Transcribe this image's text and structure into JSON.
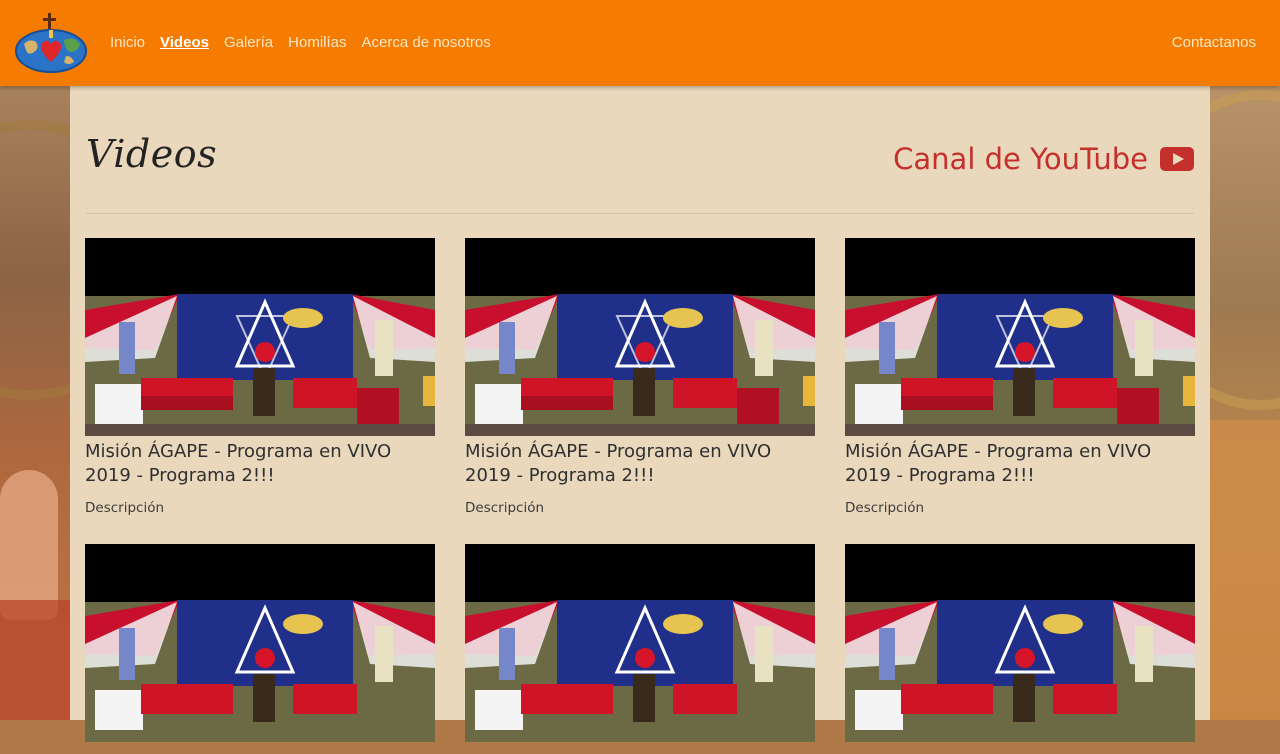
{
  "nav": {
    "links": [
      {
        "label": "Inicio"
      },
      {
        "label": "Videos"
      },
      {
        "label": "Galería"
      },
      {
        "label": "Homilías"
      },
      {
        "label": "Acerca de nosotros"
      }
    ],
    "contact_label": "Contactanos"
  },
  "page": {
    "title": "Videos",
    "youtube_label": "Canal de YouTube"
  },
  "videos": [
    {
      "title": "Misión ÁGAPE - Programa en VIVO 2019 - Programa 2!!!",
      "description": "Descripción"
    },
    {
      "title": "Misión ÁGAPE - Programa en VIVO 2019 - Programa 2!!!",
      "description": "Descripción"
    },
    {
      "title": "Misión ÁGAPE - Programa en VIVO 2019 - Programa 2!!!",
      "description": "Descripción"
    },
    {
      "title": "",
      "description": ""
    },
    {
      "title": "",
      "description": ""
    },
    {
      "title": "",
      "description": ""
    }
  ],
  "colors": {
    "navbar": "#f57c00",
    "panel": "#ead8bd",
    "youtube_red": "#c4302b",
    "nav_text": "#fde7c6"
  }
}
